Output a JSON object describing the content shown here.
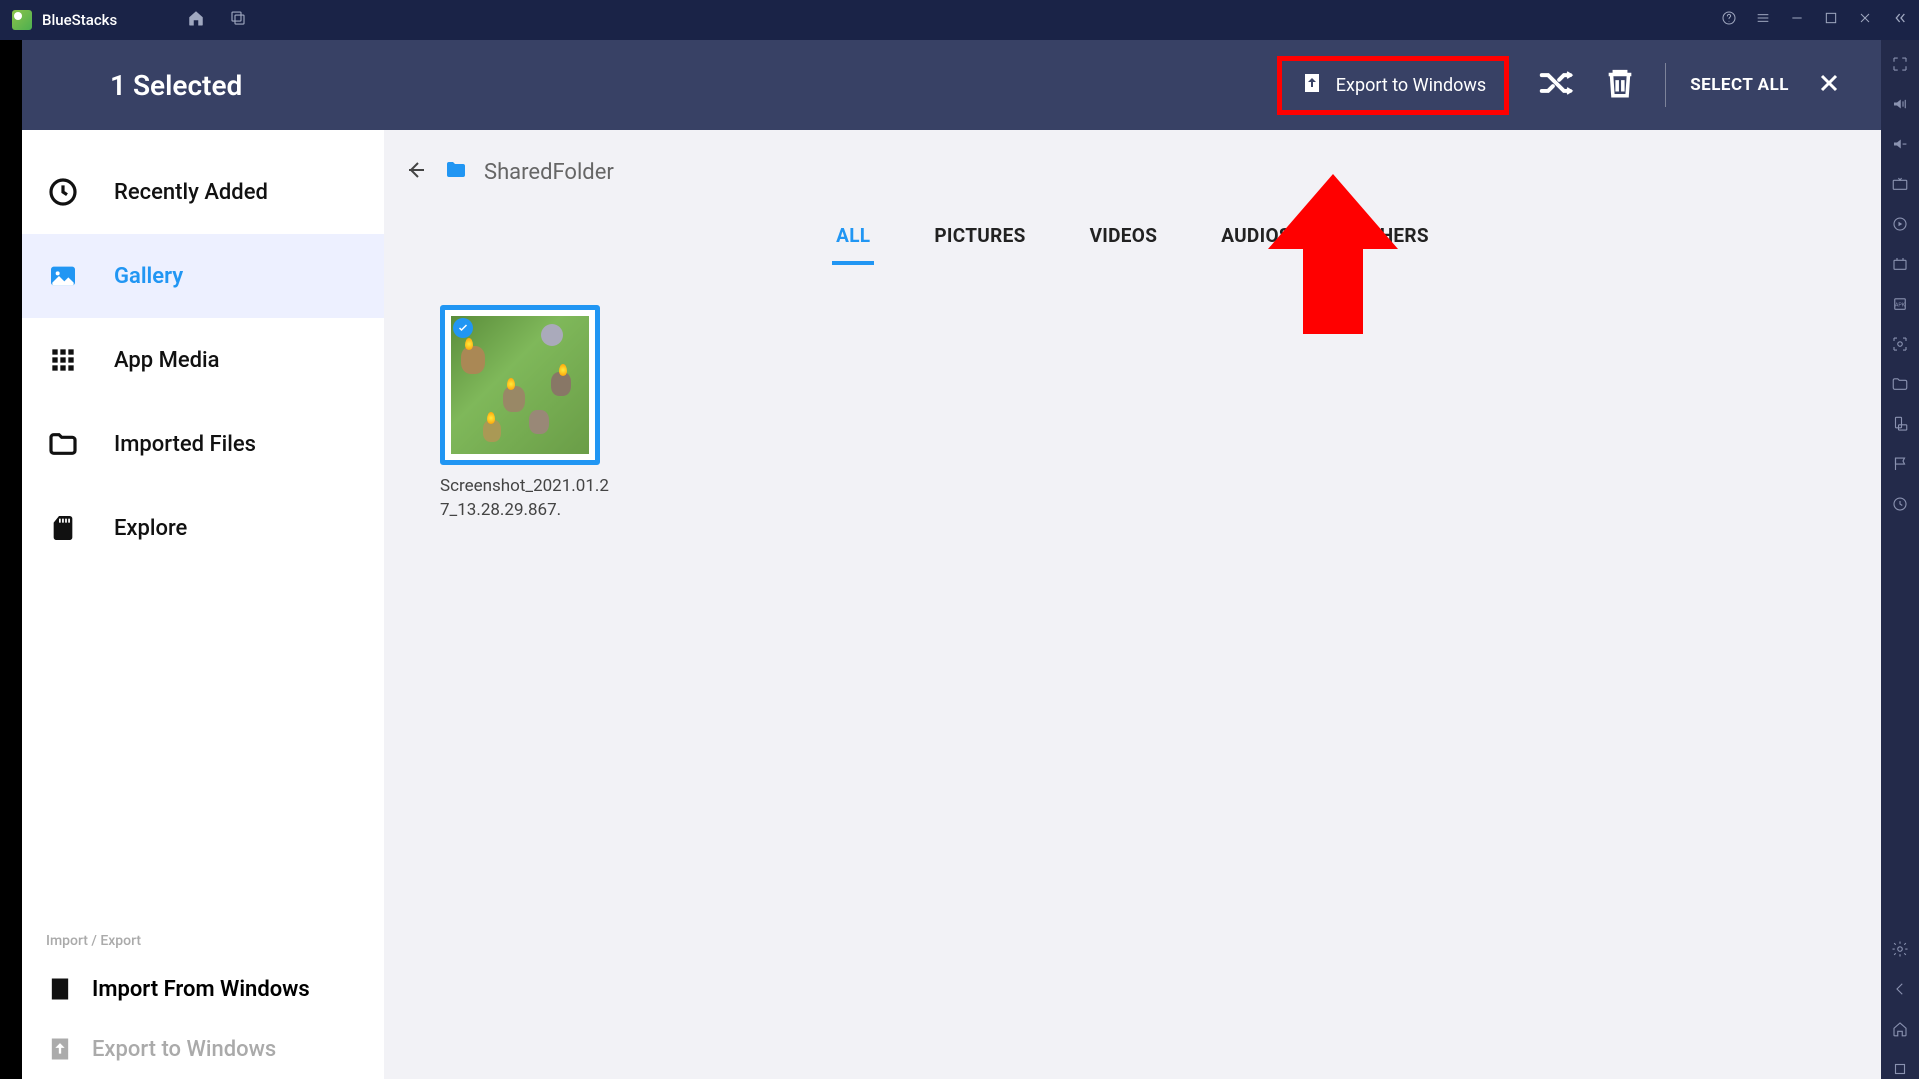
{
  "titlebar": {
    "app_name": "BlueStacks"
  },
  "selection_bar": {
    "count_text": "1 Selected",
    "export_label": "Export to Windows",
    "select_all_label": "SELECT ALL"
  },
  "sidebar": {
    "items": [
      {
        "label": "Recently Added"
      },
      {
        "label": "Gallery"
      },
      {
        "label": "App Media"
      },
      {
        "label": "Imported Files"
      },
      {
        "label": "Explore"
      }
    ],
    "section_label": "Import / Export",
    "actions": [
      {
        "label": "Import From Windows"
      },
      {
        "label": "Export to Windows"
      }
    ]
  },
  "breadcrumb": {
    "folder": "SharedFolder"
  },
  "tabs": [
    {
      "label": "ALL",
      "active": true
    },
    {
      "label": "PICTURES",
      "active": false
    },
    {
      "label": "VIDEOS",
      "active": false
    },
    {
      "label": "AUDIOS",
      "active": false
    },
    {
      "label": "OTHERS",
      "active": false
    }
  ],
  "gallery": {
    "items": [
      {
        "name": "Screenshot_2021.01.27_13.28.29.867."
      }
    ]
  }
}
